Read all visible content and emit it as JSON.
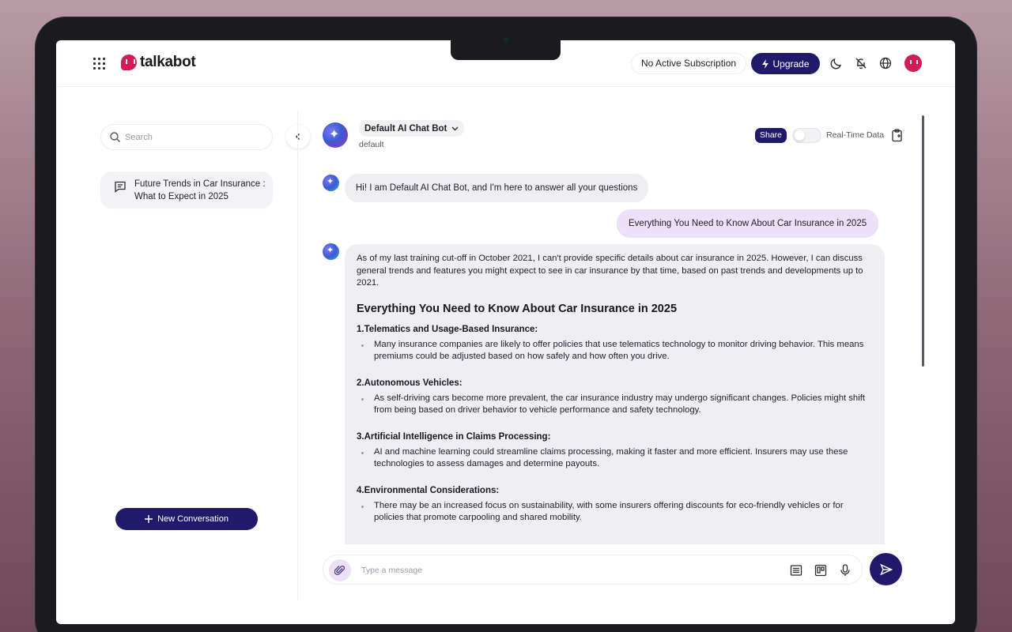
{
  "header": {
    "brand": "talkabot",
    "subscription_label": "No Active Subscription",
    "upgrade_label": "Upgrade"
  },
  "sidebar": {
    "search_placeholder": "Search",
    "conversations": [
      {
        "title": "Future Trends in Car Insurance : What to Expect in 2025"
      }
    ],
    "new_conversation_label": "New Conversation"
  },
  "chat": {
    "bot_name": "Default AI Chat Bot",
    "bot_subtitle": "default",
    "share_label": "Share",
    "realtime_label": "Real-Time Data",
    "realtime_enabled": false,
    "messages": [
      {
        "role": "bot",
        "text": "Hi! I am Default AI Chat Bot, and I'm here to answer all your questions"
      },
      {
        "role": "user",
        "text": "Everything You Need to Know About Car Insurance in 2025"
      }
    ],
    "answer": {
      "intro": "As of my last training cut-off in October 2021, I can't provide specific details about car insurance in 2025. However, I can discuss general trends and features you might expect to see in car insurance by that time, based on past trends and developments up to 2021.",
      "heading": "Everything You Need to Know About Car Insurance in 2025",
      "sections": [
        {
          "title": "1.Telematics and Usage-Based Insurance:",
          "bullet": "Many insurance companies are likely to offer policies that use telematics technology to monitor driving behavior. This means premiums could be adjusted based on how safely and how often you drive."
        },
        {
          "title": "2.Autonomous Vehicles:",
          "bullet": "As self-driving cars become more prevalent, the car insurance industry may undergo significant changes. Policies might shift from being based on driver behavior to vehicle performance and safety technology."
        },
        {
          "title": "3.Artificial Intelligence in Claims Processing:",
          "bullet": "AI and machine learning could streamline claims processing, making it faster and more efficient. Insurers may use these technologies to assess damages and determine payouts."
        },
        {
          "title": "4.Environmental Considerations:",
          "bullet": "There may be an increased focus on sustainability, with some insurers offering discounts for eco-friendly vehicles or for policies that promote carpooling and shared mobility."
        }
      ]
    },
    "composer_placeholder": "Type a message"
  },
  "colors": {
    "brand_primary": "#211a6b",
    "brand_logo": "#d01d53",
    "user_bubble": "#ede0f8",
    "bot_bubble": "#efeff3"
  },
  "icons": [
    "apps-grid-icon",
    "moon-icon",
    "notifications-off-icon",
    "globe-icon",
    "search-icon",
    "chevron-left-icon",
    "chat-icon",
    "plus-icon",
    "chevron-down-icon",
    "clipboard-icon",
    "paperclip-icon",
    "notes-icon",
    "board-icon",
    "microphone-icon",
    "send-icon",
    "bolt-icon"
  ]
}
